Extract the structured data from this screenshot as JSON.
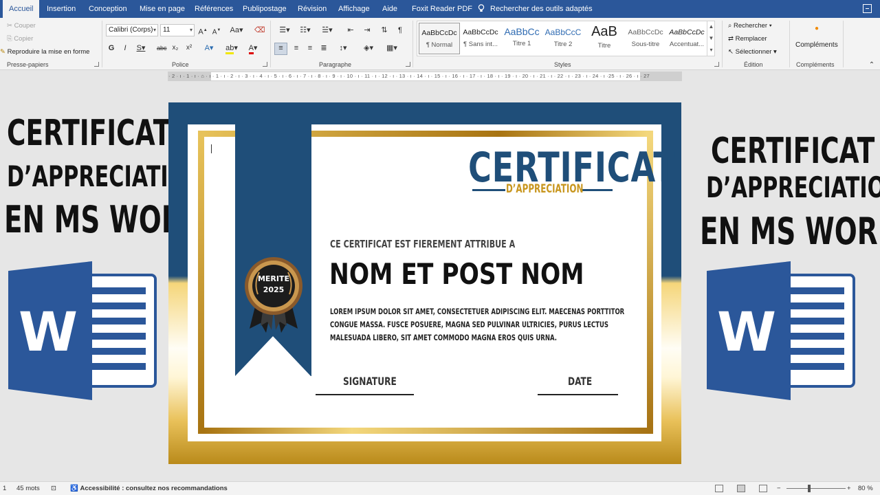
{
  "tabs": [
    "Accueil",
    "Insertion",
    "Conception",
    "Mise en page",
    "Références",
    "Publipostage",
    "Révision",
    "Affichage",
    "Aide",
    "Foxit Reader PDF"
  ],
  "tell_me": "Rechercher des outils adaptés",
  "clipboard": {
    "cut": "Couper",
    "copy": "Copier",
    "format_painter": "Reproduire la mise en forme",
    "label": "Presse-papiers"
  },
  "font": {
    "name": "Calibri (Corps)",
    "size": "11",
    "label": "Police"
  },
  "paragraph": {
    "label": "Paragraphe"
  },
  "styles": {
    "label": "Styles",
    "items": [
      {
        "sample": "AaBbCcDc",
        "name": "¶ Normal"
      },
      {
        "sample": "AaBbCcDc",
        "name": "¶ Sans int..."
      },
      {
        "sample": "AaBbCc",
        "name": "Titre 1"
      },
      {
        "sample": "AaBbCcC",
        "name": "Titre 2"
      },
      {
        "sample": "AaB",
        "name": "Titre"
      },
      {
        "sample": "AaBbCcDc",
        "name": "Sous-titre"
      },
      {
        "sample": "AaBbCcDc",
        "name": "Accentuat..."
      }
    ]
  },
  "editing": {
    "find": "Rechercher",
    "replace": "Remplacer",
    "select": "Sélectionner",
    "label": "Édition"
  },
  "addins": {
    "button": "Compléments",
    "label": "Compléments"
  },
  "ruler_text": "· 2 · ı · 1 · ı · ⌂ · ı · 1 · ı · 2 · ı · 3 · ı · 4 · ı · 5 · ı · 6 · ı · 7 · ı · 8 · ı · 9 · ı · 10 · ı · 11 · ı · 12 · ı · 13 · ı · 14 · ı · 15 · ı · 16 · ı · 17 · ı · 18 · ı · 19 · ı · 20 · ı · 21 · ı · 22 · ı · 23 · ı · 24 · ı ·25 · ı · 26 · ı · 27",
  "banner_left": {
    "line1": "CERTIFICAT",
    "line2": "D’APPRECIATION",
    "line3": "EN MS WORD"
  },
  "banner_right": {
    "line1": "CERTIFICAT",
    "line2": "D’APPRECIATION",
    "line3": "EN MS WORD"
  },
  "logo_letter": "W",
  "certificate": {
    "heading": "CERTIFICAT",
    "subheading": "D’APPRECIATION",
    "attributed": "CE CERTIFICAT EST FIEREMENT ATTRIBUE A",
    "recipient": "NOM ET POST NOM",
    "body": "LOREM IPSUM DOLOR SIT AMET, CONSECTETUER ADIPISCING ELIT. MAECENAS PORTTITOR CONGUE MASSA. FUSCE POSUERE, MAGNA SED PULVINAR ULTRICIES, PURUS LECTUS MALESUADA LIBERO, SIT AMET COMMODO MAGNA EROS QUIS URNA.",
    "signature_label": "SIGNATURE",
    "date_label": "DATE",
    "medal_line1": "MERITE",
    "medal_line2": "2025"
  },
  "status": {
    "page": "1",
    "words": "45 mots",
    "accessibility": "Accessibilité : consultez nos recommandations",
    "zoom": "80 %"
  },
  "colors": {
    "word_blue": "#2b579a",
    "cert_navy": "#1f4e79",
    "cert_gold": "#c8961e"
  }
}
